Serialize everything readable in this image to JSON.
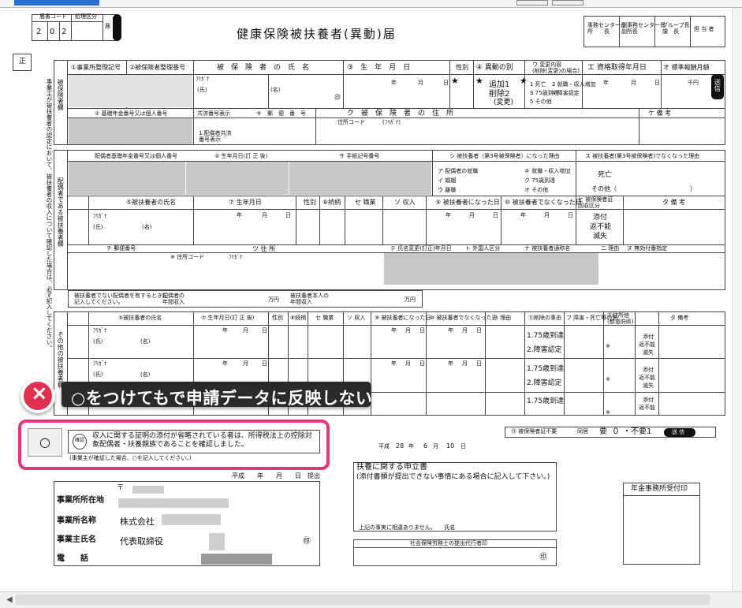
{
  "header": {
    "code_label": "届書コード",
    "proc_label": "処理区分",
    "digits": [
      "2",
      "0",
      "2"
    ],
    "todoke": "届",
    "title": "健康保険被扶養者(異動)届",
    "sho": "正",
    "approvals": [
      "事務センター長\n所　　長",
      "副事務センター長\n副所長",
      "グループ長\n課　長",
      "担 当 者"
    ]
  },
  "applicant_section": {
    "cols": {
      "a": "①事業所整理記号",
      "b": "②被保険者整理番号",
      "name": "被　保　険　者　の　氏　名",
      "birth": "③　生　年　月　日",
      "sex": "性別",
      "change": "④ 異動の別",
      "change_content": "ウ 変更内容\n(削除(変更)の場合)",
      "qualify": "エ 資格取得年月日",
      "salary": "オ 標準報酬月額"
    },
    "furigana": "ﾌﾘｶﾞﾅ",
    "shi": "(氏)",
    "mei": "(名)",
    "stamp": "㊞",
    "year": "年",
    "month": "月",
    "day": "日",
    "add": "追加1",
    "delete": "削除2",
    "change_paren": "(変更)",
    "change_options": [
      "1 死亡",
      "2 就職・収入増加",
      "3 75歳到達",
      "4 障害認定",
      "5 その他"
    ],
    "yen": "千円",
    "send": "送信",
    "section_label": "被保険者欄",
    "nenkin_label": "② 基礎年金番号又は個人番号",
    "kyosai_label": "共済番号表示",
    "post": "キ　郵　便　番　号",
    "addr": "ク　被　保　険　者　の　住　所",
    "note": "ケ 備 考",
    "addr_code": "住所コード",
    "kana": "(ﾌﾘｶﾞﾅ)",
    "kyosai_note": "1.配偶者共済\n番号表示"
  },
  "spouse_section": {
    "section_label": "配偶者である被扶養者欄",
    "nenkin": "配偶者基礎年金番号又は個人番号",
    "birth": "② 生年月日(訂 正 後)",
    "hand": "サ 手帳記号番号",
    "reason_became": "シ 被扶養者（第3号被保険者）になった理由",
    "reason_ceased": "ス 被扶養者(第3号被保険者)でなくなった理由",
    "reasons_left": [
      "ア 配偶者の就職",
      "イ 婚姻",
      "ウ 離職",
      "エ 収入減少",
      "オ その他"
    ],
    "reasons_right": [
      "カ 死亡",
      "キ 就職・収入増加",
      "ク 75歳到達",
      "ケ その他"
    ],
    "death": "死亡",
    "other": "その他（",
    "paren_close": "）",
    "name": "⑤被扶養者の氏名",
    "birth2": "⑦ 生年月日",
    "sex": "性別",
    "rel": "⑧続柄",
    "job": "セ 職業",
    "income": "ソ 収入",
    "became": "⑨ 被扶養者になった日",
    "ceased": "⑩ 被扶養者でなくなった日",
    "card": "ヒ 被保険者証\n回収区分",
    "biko": "タ 備 考",
    "attach": "添付",
    "unable": "返不能",
    "lost": "滅失",
    "zip": "チ 郵便番号",
    "address": "ツ 住 所",
    "addr_code": "※ 住所コード",
    "kana": "ﾌﾘｶﾞﾅ",
    "namechg": "テ 氏名変更(訂正)年月日",
    "foreign": "ト 外国人区分",
    "passport": "ナ 被扶養者通称名",
    "ni": "ニ 理由",
    "nu": "ヌ 無効付番指定",
    "income_note": "被扶養者でない配偶者を有するときに\n記入してください。",
    "spouse_income": "配偶者の\n年間収入",
    "man_yen": "万円",
    "ins_income": "被扶養者本人の\n年間収入",
    "man_yen2": "万円"
  },
  "other_section": {
    "section_label": "その他の被扶養者欄",
    "name": "⑤被扶養者の氏名",
    "birth": "⑦ 生年月日(訂 正 後)",
    "sex": "性別",
    "rel": "⑧続柄",
    "job": "セ 職業",
    "income": "ソ 収入",
    "became": "⑨ 被扶養者になった日",
    "ceased": "⑩ 被扶養者でなくなった日",
    "ha": "ハ 理由",
    "reason": "⑪削除の事由",
    "hi": "フ 障害・死亡等の別",
    "residence": "⑫住所他\n(都道府県)",
    "biko": "タ 備考",
    "age75": "1.75歳到達",
    "disability": "2.障害認定",
    "attach": "添付",
    "unable": "返不能",
    "lost": "滅失",
    "kome": "※",
    "furigana": "ﾌﾘｶﾞﾅ",
    "shi": "(氏)",
    "mei": "(名)"
  },
  "confirm": {
    "check_value": "○",
    "confirm_mark": "確認",
    "text": "収入に関する証明の添付が省略されている者は、所得税法上の控除対\n象配偶者・扶養親族であることを確認しました。",
    "sub": "(事業主が確認した場合、○を記入してください。)",
    "date_era": "平成",
    "date_year": "28",
    "date_y": "年",
    "date_month": "6",
    "date_m": "月",
    "date_day": "10",
    "date_d": "日",
    "card_unneeded": "⑬ 被保険者証不要",
    "dou": "同居",
    "need": "要",
    "zero": "０",
    "fuyo": "・不要",
    "one": "1",
    "send": "送 信"
  },
  "bottom": {
    "postal_mark": "〒",
    "date_line": "平成　　年　　月　　日　提出",
    "address_label": "事業所所在地",
    "office_label": "事業所名称",
    "owner_label": "事業主氏名",
    "phone_label": "電　　話",
    "company": "株式会社",
    "rep": "代表取締役",
    "stamp": "㊞",
    "petition_title": "扶養に関する申立書",
    "petition_sub": "(添付書類が提出できない事情にある場合に記入して下さい。)",
    "petition_sig": "上記の事実に相違ありません。　　氏名",
    "sharoushi": "社会保険労務士の提出代行者印",
    "sharoushi_stamp": "㊞",
    "pension_office": "年金事務所受付印"
  },
  "banner": {
    "text": "○をつけてもで申請データに反映しない",
    "icon": "×"
  },
  "side_note": "事業主が被扶養者の認定において、被扶養者の収入について確認した場合は、必ず記入してください。"
}
